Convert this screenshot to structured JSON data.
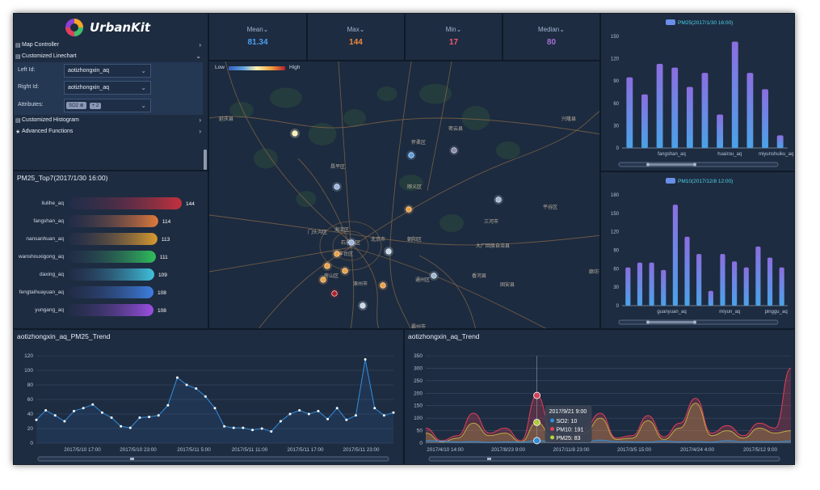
{
  "app": {
    "title": "UrbanKit"
  },
  "menu": {
    "map_controller": "Map Controller",
    "customized_linechart": "Customized Linechart",
    "left_id_label": "Left Id:",
    "left_id_value": "aotizhongxin_aq",
    "right_id_label": "Right Id:",
    "right_id_value": "aotizhongxin_aq",
    "attributes_label": "Attributes:",
    "attribute_tag": "SO2",
    "attribute_more": "+ 2",
    "customized_histogram": "Customized Histogram",
    "advanced_functions": "Advanced Functions"
  },
  "stats": [
    {
      "label": "Mean",
      "value": "81.34",
      "color": "#4a9ff0"
    },
    {
      "label": "Max",
      "value": "144",
      "color": "#ef8a3c"
    },
    {
      "label": "Min",
      "value": "17",
      "color": "#ef5a70"
    },
    {
      "label": "Median",
      "value": "80",
      "color": "#a56fd6"
    }
  ],
  "map": {
    "legend_low": "Low",
    "legend_high": "High",
    "labels": [
      {
        "t": "延庆县"
      },
      {
        "t": "怀柔区"
      },
      {
        "t": "兴隆县"
      },
      {
        "t": "昌平区"
      },
      {
        "t": "顺义区"
      },
      {
        "t": "密云县"
      },
      {
        "t": "平谷区"
      },
      {
        "t": "门头沟区"
      },
      {
        "t": "海淀区"
      },
      {
        "t": "北京市"
      },
      {
        "t": "朝阳区"
      },
      {
        "t": "通州区"
      },
      {
        "t": "石景山区"
      },
      {
        "t": "丰台区"
      },
      {
        "t": "房山区"
      },
      {
        "t": "大厂回族自治县"
      },
      {
        "t": "三河市"
      },
      {
        "t": "香河县"
      },
      {
        "t": "固安县"
      },
      {
        "t": "霸州市"
      },
      {
        "t": "涿州市"
      },
      {
        "t": "廊坊市"
      }
    ]
  },
  "top7": {
    "title": "PM25_Top7(2017/1/30 16:00)",
    "colors": [
      [
        "#2b2f55",
        "#c5303c"
      ],
      [
        "#2b2f55",
        "#e07a3a"
      ],
      [
        "#2b2f55",
        "#d99a2e"
      ],
      [
        "#2b2f55",
        "#2fbe5c"
      ],
      [
        "#2b2f55",
        "#3fc2dc"
      ],
      [
        "#2b2f55",
        "#3d7fe0"
      ],
      [
        "#2b2f55",
        "#9a4fe0"
      ]
    ]
  },
  "trend1": {
    "title": "aotizhongxin_aq_PM25_Trend"
  },
  "trend2": {
    "title": "aotizhongxin_aq_Trend",
    "tooltip_title": "2017/9/21 9:00",
    "tooltip_rows": [
      {
        "label": "SO2: 10",
        "color": "#2f8ee0"
      },
      {
        "label": "PM10: 191",
        "color": "#e0405a"
      },
      {
        "label": "PM25: 83",
        "color": "#b7d43a"
      }
    ]
  },
  "chart_data": [
    {
      "type": "bar",
      "id": "pm25-bar",
      "title": "",
      "legend": "PM25(2017/1/30 16:00)",
      "categories": [
        "fangshan_aq",
        "huairou_aq",
        "miyunshuiku_aq"
      ],
      "values": [
        95,
        72,
        113,
        108,
        82,
        101,
        45,
        143,
        101,
        79,
        17
      ],
      "ylim": [
        0,
        150
      ],
      "yticks": [
        0,
        30,
        60,
        90,
        120,
        150
      ],
      "color": "#7a6cdc"
    },
    {
      "type": "bar",
      "id": "pm10-bar",
      "title": "",
      "legend": "PM10(2017/12/8 12:00)",
      "categories": [
        "guanyuan_aq",
        "miyun_aq",
        "pinggu_aq"
      ],
      "values": [
        62,
        70,
        70,
        58,
        164,
        112,
        84,
        24,
        84,
        72,
        62,
        96,
        78,
        62
      ],
      "ylim": [
        0,
        180
      ],
      "yticks": [
        0,
        30,
        60,
        90,
        120,
        150,
        180
      ],
      "color": "#7a6cdc"
    },
    {
      "type": "bar",
      "id": "top7",
      "title": "PM25_Top7(2017/1/30 16:00)",
      "categories": [
        "liulihe_aq",
        "fangshan_aq",
        "nansanhuan_aq",
        "wanshouxigong_aq",
        "daxing_aq",
        "fengtaihuayuan_aq",
        "yungang_aq"
      ],
      "values": [
        144,
        114,
        113,
        111,
        109,
        108,
        108
      ]
    },
    {
      "type": "line",
      "id": "pm25-trend",
      "title": "aotizhongxin_aq_PM25_Trend",
      "x_labels": [
        "2017/5/10 17:00",
        "2017/5/10 23:00",
        "2017/5/11 5:00",
        "2017/5/11 11:00",
        "2017/5/11 17:00",
        "2017/5/11 23:00"
      ],
      "values": [
        32,
        45,
        38,
        30,
        44,
        48,
        53,
        42,
        35,
        23,
        21,
        35,
        36,
        38,
        52,
        90,
        80,
        75,
        64,
        48,
        23,
        21,
        21,
        18,
        20,
        16,
        30,
        40,
        45,
        40,
        44,
        33,
        48,
        32,
        38,
        115,
        48,
        38,
        42
      ],
      "ylim": [
        0,
        120
      ],
      "yticks": [
        0,
        20,
        40,
        60,
        80,
        100,
        120
      ]
    },
    {
      "type": "area",
      "id": "multi-trend",
      "title": "aotizhongxin_aq_Trend",
      "x_labels": [
        "2017/4/10 14:00",
        "2017/8/23 9:00",
        "2017/11/8 23:00",
        "2017/3/5 15:00",
        "2017/4/24 4:00",
        "2017/5/12 9:00"
      ],
      "series": [
        {
          "name": "SO2",
          "color": "#2f8ee0",
          "values": [
            10,
            8,
            4,
            6,
            3,
            5,
            4,
            10,
            6,
            8,
            4,
            12,
            6,
            5,
            4,
            8,
            5,
            6,
            4,
            10,
            5,
            6,
            5,
            8
          ]
        },
        {
          "name": "PM10",
          "color": "#e0405a",
          "values": [
            60,
            10,
            30,
            120,
            40,
            60,
            10,
            191,
            40,
            20,
            60,
            120,
            20,
            30,
            110,
            25,
            80,
            180,
            40,
            70,
            30,
            80,
            60,
            300
          ]
        },
        {
          "name": "PM25",
          "color": "#b7d43a",
          "values": [
            40,
            5,
            20,
            80,
            30,
            40,
            5,
            83,
            25,
            15,
            40,
            100,
            15,
            20,
            90,
            15,
            60,
            160,
            30,
            50,
            20,
            60,
            40,
            50
          ]
        }
      ],
      "ylim": [
        0,
        350
      ],
      "yticks": [
        0,
        50,
        100,
        150,
        200,
        250,
        300,
        350
      ]
    }
  ]
}
